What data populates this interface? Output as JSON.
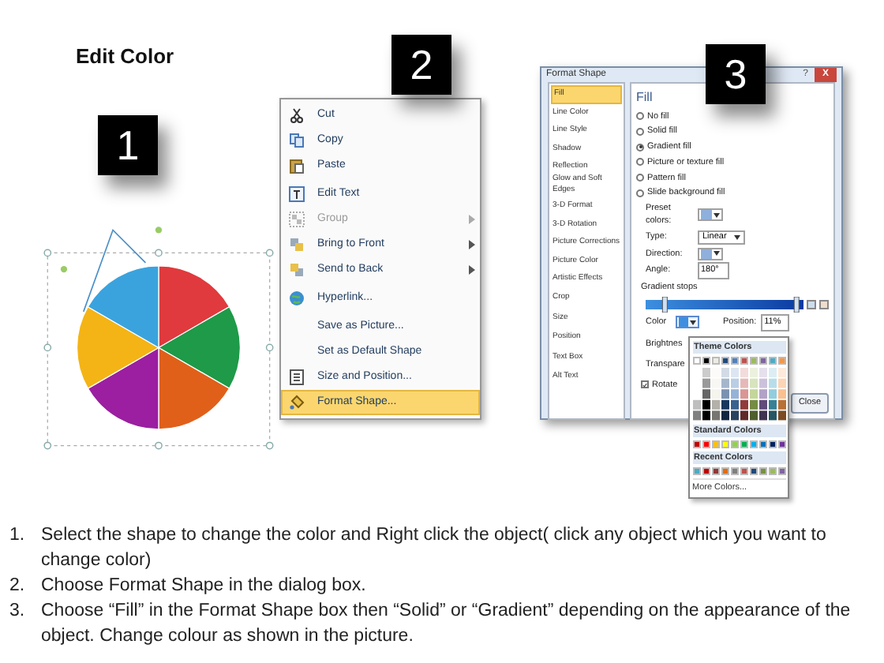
{
  "title": "Edit Color",
  "badges": [
    "1",
    "2",
    "3"
  ],
  "context_menu": {
    "items": [
      {
        "label": "Cut",
        "kind": "scissors",
        "disabled": false,
        "submenu": false,
        "selected": false
      },
      {
        "label": "Copy",
        "kind": "copy",
        "disabled": false,
        "submenu": false,
        "selected": false
      },
      {
        "label": "Paste",
        "kind": "paste",
        "disabled": false,
        "submenu": false,
        "selected": false
      },
      {
        "label": "Edit Text",
        "kind": "text",
        "disabled": false,
        "submenu": false,
        "selected": false
      },
      {
        "label": "Group",
        "kind": "group",
        "disabled": true,
        "submenu": true,
        "selected": false
      },
      {
        "label": "Bring to Front",
        "kind": "front",
        "disabled": false,
        "submenu": true,
        "selected": false
      },
      {
        "label": "Send to Back",
        "kind": "back",
        "disabled": false,
        "submenu": true,
        "selected": false
      },
      {
        "label": "Hyperlink...",
        "kind": "globe",
        "disabled": false,
        "submenu": false,
        "selected": false
      },
      {
        "label": "Save as Picture...",
        "kind": "plain",
        "disabled": false,
        "submenu": false,
        "selected": false
      },
      {
        "label": "Set as Default Shape",
        "kind": "plain",
        "disabled": false,
        "submenu": false,
        "selected": false
      },
      {
        "label": "Size and Position...",
        "kind": "size",
        "disabled": false,
        "submenu": false,
        "selected": false
      },
      {
        "label": "Format Shape...",
        "kind": "format",
        "disabled": false,
        "submenu": false,
        "selected": true
      }
    ]
  },
  "dialog": {
    "title": "Format Shape",
    "help": "?",
    "close": "X",
    "categories": [
      {
        "label": "Fill",
        "selected": true
      },
      {
        "label": "Line Color",
        "selected": false
      },
      {
        "label": "Line Style",
        "selected": false
      },
      {
        "label": "Shadow",
        "selected": false
      },
      {
        "label": "Reflection",
        "selected": false
      },
      {
        "label": "Glow and Soft Edges",
        "selected": false
      },
      {
        "label": "3-D Format",
        "selected": false
      },
      {
        "label": "3-D Rotation",
        "selected": false
      },
      {
        "label": "Picture Corrections",
        "selected": false
      },
      {
        "label": "Picture Color",
        "selected": false
      },
      {
        "label": "Artistic Effects",
        "selected": false
      },
      {
        "label": "Crop",
        "selected": false
      },
      {
        "label": "Size",
        "selected": false
      },
      {
        "label": "Position",
        "selected": false
      },
      {
        "label": "Text Box",
        "selected": false
      },
      {
        "label": "Alt Text",
        "selected": false
      }
    ],
    "heading": "Fill",
    "fill_options": [
      {
        "label": "No fill",
        "selected": false
      },
      {
        "label": "Solid fill",
        "selected": false
      },
      {
        "label": "Gradient fill",
        "selected": true
      },
      {
        "label": "Picture or texture fill",
        "selected": false
      },
      {
        "label": "Pattern fill",
        "selected": false
      },
      {
        "label": "Slide background fill",
        "selected": false
      }
    ],
    "gradient_stops": [
      {
        "level": 0.11
      },
      {
        "level": 0.97
      }
    ],
    "preset_label": "Preset colors:",
    "type_label": "Type:",
    "type_value": "Linear",
    "direction_label": "Direction:",
    "angle_label": "Angle:",
    "angle_value": "180°",
    "stops_label": "Gradient stops",
    "color_label": "Color",
    "position_label": "Position:",
    "position_value": "11%",
    "brightness_label": "Brightnes",
    "transparency_label": "Transpare",
    "rotate_label": "Rotate",
    "rotate_checked": true,
    "close_button": "Close"
  },
  "palette": {
    "theme_label": "Theme Colors",
    "theme": [
      {
        "color": "#ffffff"
      },
      {
        "color": "#000000"
      },
      {
        "color": "#eeece1"
      },
      {
        "color": "#1f497d"
      },
      {
        "color": "#4f81bd"
      },
      {
        "color": "#c0504d"
      },
      {
        "color": "#9bbb59"
      },
      {
        "color": "#8064a2"
      },
      {
        "color": "#4bacc6"
      },
      {
        "color": "#f79646"
      }
    ],
    "standard_label": "Standard Colors",
    "standard": [
      {
        "color": "#c00000"
      },
      {
        "color": "#ff0000"
      },
      {
        "color": "#ffc000"
      },
      {
        "color": "#ffff00"
      },
      {
        "color": "#92d050"
      },
      {
        "color": "#00b050"
      },
      {
        "color": "#00b0f0"
      },
      {
        "color": "#0070c0"
      },
      {
        "color": "#002060"
      },
      {
        "color": "#7030a0"
      }
    ],
    "recent_label": "Recent Colors",
    "recent": [
      {
        "color": "#4bacc6"
      },
      {
        "color": "#c00000"
      },
      {
        "color": "#953735"
      },
      {
        "color": "#e46c0a"
      },
      {
        "color": "#7f7f7f"
      },
      {
        "color": "#c0504d"
      },
      {
        "color": "#1f497d"
      },
      {
        "color": "#77933c"
      },
      {
        "color": "#9bbb59"
      },
      {
        "color": "#8064a2"
      }
    ],
    "more": "More Colors..."
  },
  "steps": [
    {
      "number": "1.",
      "text": "Select the shape to change the color and Right click the object( click any object which you want to change color)"
    },
    {
      "number": "2.",
      "text": "Choose Format Shape in the dialog box."
    },
    {
      "number": "3.",
      "text": "Choose “Fill” in the Format Shape box then “Solid” or “Gradient” depending on the appearance of the object. Change colour as shown in the picture."
    }
  ]
}
